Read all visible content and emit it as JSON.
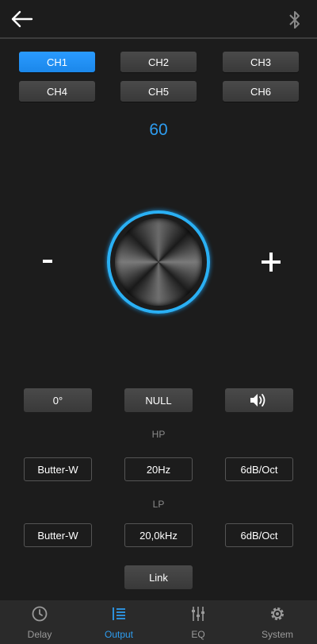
{
  "channels": [
    "CH1",
    "CH2",
    "CH3",
    "CH4",
    "CH5",
    "CH6"
  ],
  "active_channel": "CH1",
  "level": "60",
  "controls": {
    "phase": "0°",
    "null_label": "NULL",
    "mute_icon": "speaker-icon"
  },
  "hp": {
    "label": "HP",
    "type": "Butter-W",
    "freq": "20Hz",
    "slope": "6dB/Oct"
  },
  "lp": {
    "label": "LP",
    "type": "Butter-W",
    "freq": "20,0kHz",
    "slope": "6dB/Oct"
  },
  "link_label": "Link",
  "tabs": [
    {
      "label": "Delay",
      "icon": "clock-icon"
    },
    {
      "label": "Output",
      "icon": "list-icon"
    },
    {
      "label": "EQ",
      "icon": "sliders-icon"
    },
    {
      "label": "System",
      "icon": "gear-icon"
    }
  ],
  "active_tab": "Output",
  "colors": {
    "accent": "#2e9df0",
    "background": "#1c1c1c",
    "ring": "#2ab0f4"
  }
}
